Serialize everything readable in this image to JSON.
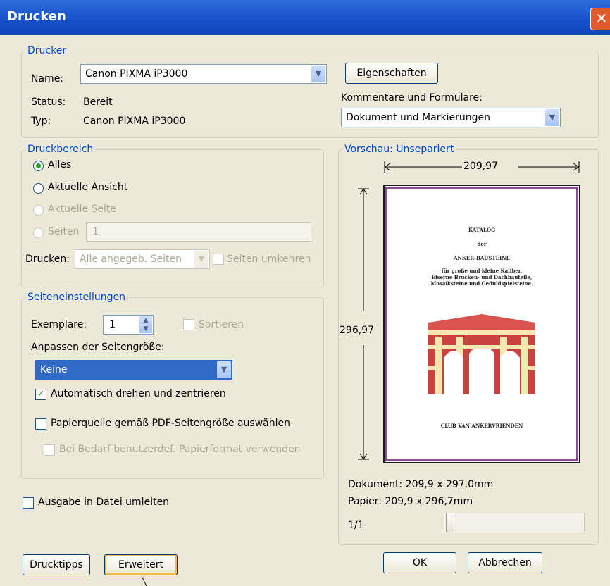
{
  "window": {
    "title": "Drucken",
    "close_glyph": "✕"
  },
  "printer": {
    "legend": "Drucker",
    "name_label": "Name:",
    "name_value": "Canon PIXMA iP3000",
    "status_label": "Status:",
    "status_value": "Bereit",
    "type_label": "Typ:",
    "type_value": "Canon PIXMA iP3000",
    "properties_button": "Eigenschaften",
    "comments_label": "Kommentare und Formulare:",
    "comments_value": "Dokument und Markierungen"
  },
  "range": {
    "legend": "Druckbereich",
    "all": "Alles",
    "current_view": "Aktuelle Ansicht",
    "current_page": "Aktuelle Seite",
    "pages": "Seiten",
    "pages_value": "1",
    "print_label": "Drucken:",
    "print_value": "Alle angegeb. Seiten",
    "reverse": "Seiten umkehren"
  },
  "setup": {
    "legend": "Seiteneinstellungen",
    "copies_label": "Exemplare:",
    "copies_value": "1",
    "collate": "Sortieren",
    "fit_label": "Anpassen der Seitengröße:",
    "fit_value": "Keine",
    "auto_rotate": "Automatisch drehen und zentrieren",
    "paper_source": "Papierquelle gemäß PDF-Seitengröße auswählen",
    "custom_paper": "Bei Bedarf benutzerdef. Papierformat verwenden"
  },
  "print_to_file": "Ausgabe in Datei umleiten",
  "preview": {
    "legend": "Vorschau: Unsepariert",
    "width": "209,97",
    "height": "296,97",
    "page_lines": [
      "KATALOG",
      "der",
      "ANKER-BAUSTEINE",
      "für große und kleine Kaliber.",
      "Eiserne Brücken- und Dachbauteile,",
      "Mosaiksteine und Geduldspielsteine.",
      "CLUB VAN ANKERVRIENDEN"
    ],
    "document_size": "Dokument: 209,9 x 297,0mm",
    "paper_size": "Papier: 209,9 x 296,7mm",
    "page_counter": "1/1"
  },
  "buttons": {
    "tips": "Drucktipps",
    "advanced": "Erweitert",
    "ok": "OK",
    "cancel": "Abbrechen"
  },
  "colors": {
    "title_bar": "#1650c9",
    "legend": "#0046d5",
    "dialog_bg": "#ece9d8",
    "selection": "#316ac5",
    "page_border": "#8b4e9c"
  },
  "icons": {
    "close": "close-icon",
    "dropdown": "chevron-down-icon",
    "spinner": "spinner-arrows-icon",
    "check": "checkmark-icon"
  }
}
